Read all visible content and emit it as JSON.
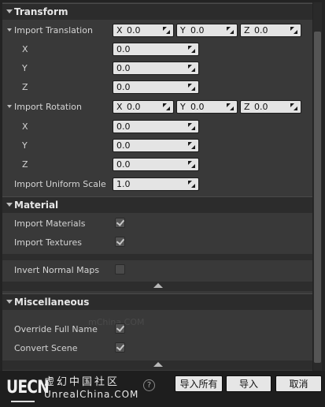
{
  "transform": {
    "title": "Transform",
    "import_translation": {
      "label": "Import Translation",
      "x_prefix": "X",
      "x": "0.0",
      "y_prefix": "Y",
      "y": "0.0",
      "z_prefix": "Z",
      "z": "0.0"
    },
    "translation_rows": [
      {
        "label": "X",
        "value": "0.0"
      },
      {
        "label": "Y",
        "value": "0.0"
      },
      {
        "label": "Z",
        "value": "0.0"
      }
    ],
    "import_rotation": {
      "label": "Import Rotation",
      "x_prefix": "X",
      "x": "0.0",
      "y_prefix": "Y",
      "y": "0.0",
      "z_prefix": "Z",
      "z": "0.0"
    },
    "rotation_rows": [
      {
        "label": "X",
        "value": "0.0"
      },
      {
        "label": "Y",
        "value": "0.0"
      },
      {
        "label": "Z",
        "value": "0.0"
      }
    ],
    "uniform_scale": {
      "label": "Import Uniform Scale",
      "value": "1.0"
    }
  },
  "material": {
    "title": "Material",
    "import_materials": {
      "label": "Import Materials",
      "checked": true
    },
    "import_textures": {
      "label": "Import Textures",
      "checked": true
    },
    "invert_normal_maps": {
      "label": "Invert Normal Maps",
      "checked": false
    }
  },
  "miscellaneous": {
    "title": "Miscellaneous",
    "override_full_name": {
      "label": "Override Full Name",
      "checked": true
    },
    "convert_scene": {
      "label": "Convert Scene",
      "checked": true
    },
    "watermark": "mChina.COM"
  },
  "footer": {
    "logo_text": "UECN",
    "brand_cn": "虚幻中国社区",
    "brand_site": "UnrealChina.COM",
    "help": "?",
    "import_all_label": "导入所有",
    "import_label": "导入",
    "cancel_label": "取消"
  },
  "colors": {
    "background": "#393939",
    "header": "#2c2c2c",
    "field": "#e4e4e4",
    "footer": "#1e1e1e"
  }
}
